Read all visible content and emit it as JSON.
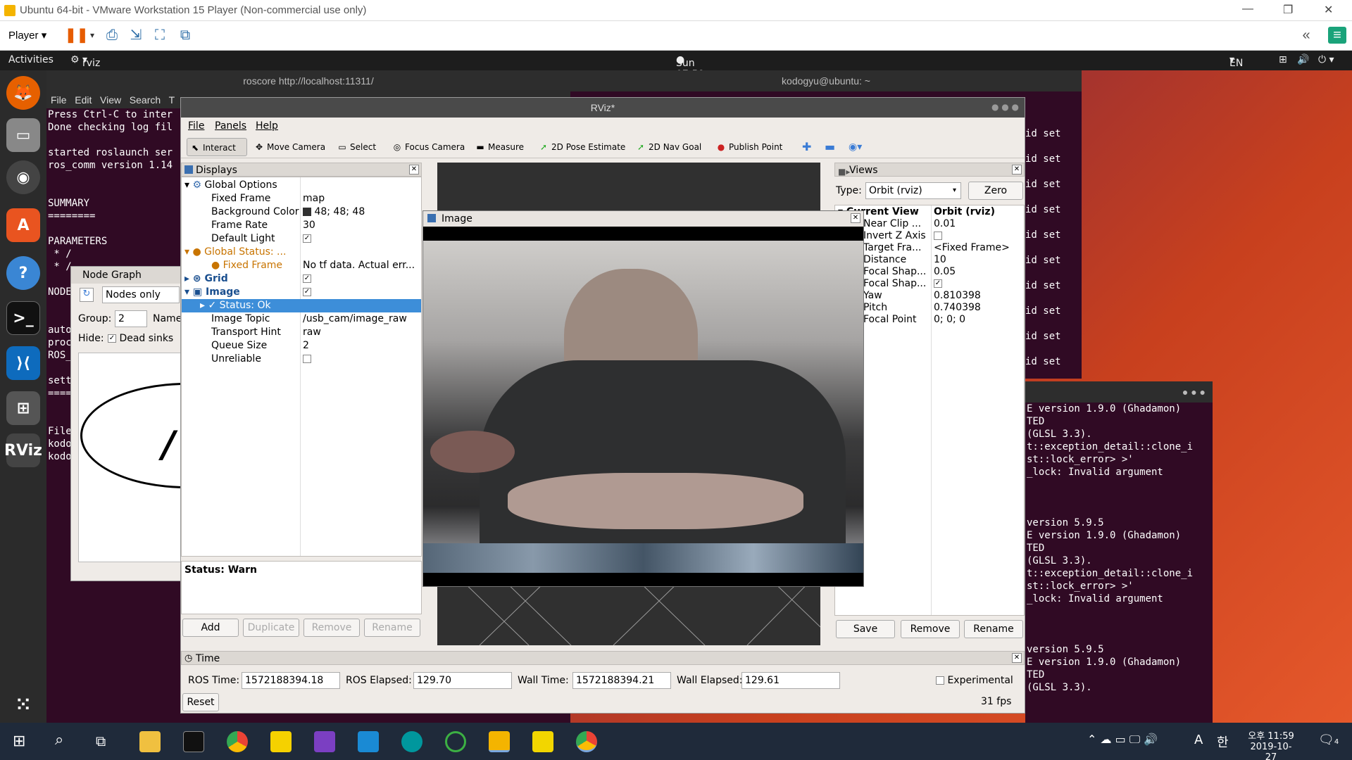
{
  "vmware": {
    "title": "Ubuntu 64-bit - VMware Workstation 15 Player (Non-commercial use only)",
    "player_label": "Player",
    "window_controls": [
      "—",
      "❐",
      "✕"
    ]
  },
  "ubuntu_topbar": {
    "activities": "Activities",
    "app": "rviz",
    "clock": "Sun 07:59",
    "lang": "EN"
  },
  "terminal_left": {
    "title": "roscore http://localhost:11311/",
    "menu": [
      "File",
      "Edit",
      "View",
      "Search",
      "T"
    ],
    "lines": [
      "Press Ctrl-C to inter",
      "Done checking log fil",
      "",
      "started roslaunch ser",
      "ros_comm version 1.14",
      "",
      "",
      "SUMMARY",
      "========",
      "",
      "PARAMETERS",
      " * /",
      " * /",
      "",
      "NODE",
      "",
      "",
      "auto",
      "proc",
      "ROS_",
      "",
      "sett",
      "====",
      "",
      "",
      "File",
      "kodo",
      "kodo"
    ]
  },
  "terminal_top_right": {
    "title": "kodogyu@ubuntu: ~",
    "lines": [
      "id set",
      "id set",
      "id set",
      "id set",
      "id set",
      "id set",
      "id set",
      "id set",
      "id set",
      "id set",
      "id set"
    ]
  },
  "terminal_bottom_right": {
    "lines": [
      "E version 1.9.0 (Ghadamon)",
      "TED",
      "(GLSL 3.3).",
      "t::exception_detail::clone_i",
      "st::lock_error> >'",
      "_lock: Invalid argument",
      "",
      "",
      "",
      "version 5.9.5",
      "E version 1.9.0 (Ghadamon)",
      "TED",
      "(GLSL 3.3).",
      "t::exception_detail::clone_i",
      "st::lock_error> >'",
      "_lock: Invalid argument",
      "",
      "",
      "",
      "version 5.9.5",
      "E version 1.9.0 (Ghadamon)",
      "TED",
      "(GLSL 3.3)."
    ]
  },
  "node_graph": {
    "title": "Node Graph",
    "mode": "Nodes only",
    "group_label": "Group:",
    "group_value": "2",
    "name_label": "Name",
    "hide_label": "Hide:",
    "dead_sinks": "Dead sinks",
    "node_letter": "/"
  },
  "rviz": {
    "title": "RViz*",
    "menu": {
      "file": "File",
      "panels": "Panels",
      "help": "Help"
    },
    "tools": {
      "interact": "Interact",
      "move_camera": "Move Camera",
      "select": "Select",
      "focus_camera": "Focus Camera",
      "measure": "Measure",
      "pose_estimate": "2D Pose Estimate",
      "nav_goal": "2D Nav Goal",
      "publish_point": "Publish Point"
    },
    "displays": {
      "title": "Displays",
      "global_options": "Global Options",
      "fixed_frame_label": "Fixed Frame",
      "fixed_frame_value": "map",
      "bg_color_label": "Background Color",
      "bg_color_value": "48; 48; 48",
      "frame_rate_label": "Frame Rate",
      "frame_rate_value": "30",
      "default_light_label": "Default Light",
      "global_status": "Global Status: ...",
      "gs_fixed_frame": "Fixed Frame",
      "gs_fixed_frame_value": "No tf data.  Actual err...",
      "grid": "Grid",
      "image": "Image",
      "status_ok": "Status: Ok",
      "image_topic_label": "Image Topic",
      "image_topic_value": "/usb_cam/image_raw",
      "transport_hint_label": "Transport Hint",
      "transport_hint_value": "raw",
      "queue_size_label": "Queue Size",
      "queue_size_value": "2",
      "unreliable_label": "Unreliable",
      "status_text": "Status: Warn",
      "buttons": {
        "add": "Add",
        "duplicate": "Duplicate",
        "remove": "Remove",
        "rename": "Rename"
      }
    },
    "image_window": {
      "title": "Image"
    },
    "views": {
      "title": "Views",
      "type_label": "Type:",
      "type_value": "Orbit (rviz)",
      "zero": "Zero",
      "current_view": "Current View",
      "current_view_value": "Orbit (rviz)",
      "props": [
        {
          "k": "Near Clip ...",
          "v": "0.01"
        },
        {
          "k": "Invert Z Axis",
          "v": ""
        },
        {
          "k": "Target Fra...",
          "v": "<Fixed Frame>"
        },
        {
          "k": "Distance",
          "v": "10"
        },
        {
          "k": "Focal Shap...",
          "v": "0.05"
        },
        {
          "k": "Focal Shap...",
          "v": ""
        },
        {
          "k": "Yaw",
          "v": "0.810398"
        },
        {
          "k": "Pitch",
          "v": "0.740398"
        },
        {
          "k": "Focal Point",
          "v": "0; 0; 0"
        }
      ],
      "buttons": {
        "save": "Save",
        "remove": "Remove",
        "rename": "Rename"
      }
    },
    "time": {
      "title": "Time",
      "ros_time_label": "ROS Time:",
      "ros_time": "1572188394.18",
      "ros_elapsed_label": "ROS Elapsed:",
      "ros_elapsed": "129.70",
      "wall_time_label": "Wall Time:",
      "wall_time": "1572188394.21",
      "wall_elapsed_label": "Wall Elapsed:",
      "wall_elapsed": "129.61",
      "experimental": "Experimental",
      "reset": "Reset",
      "fps": "31 fps"
    }
  },
  "taskbar": {
    "time": "오후 11:59",
    "date": "2019-10-27",
    "ime": "A",
    "ime2": "한",
    "notif": "4"
  }
}
